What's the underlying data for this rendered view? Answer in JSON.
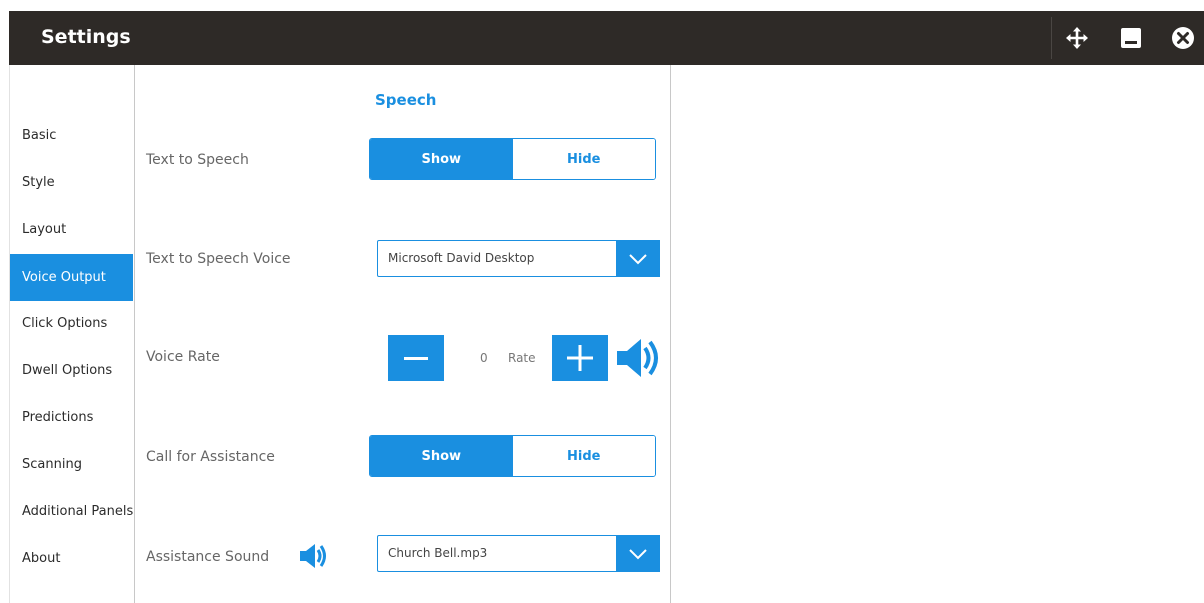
{
  "window": {
    "title": "Settings",
    "icons": {
      "move": "move-arrows-icon",
      "minimize": "minimize-icon",
      "close": "close-circle-icon"
    }
  },
  "sidebar": {
    "items": [
      {
        "label": "Basic",
        "active": false
      },
      {
        "label": "Style",
        "active": false
      },
      {
        "label": "Layout",
        "active": false
      },
      {
        "label": "Voice Output",
        "active": true
      },
      {
        "label": "Click Options",
        "active": false
      },
      {
        "label": "Dwell Options",
        "active": false
      },
      {
        "label": "Predictions",
        "active": false
      },
      {
        "label": "Scanning",
        "active": false
      },
      {
        "label": "Additional Panels",
        "active": false
      },
      {
        "label": "About",
        "active": false
      }
    ]
  },
  "main": {
    "section_title": "Speech",
    "text_to_speech": {
      "label": "Text to Speech",
      "show": "Show",
      "hide": "Hide",
      "selected": "Show"
    },
    "voice": {
      "label": "Text to Speech Voice",
      "value": "Microsoft David Desktop"
    },
    "voice_rate": {
      "label": "Voice Rate",
      "value": "0",
      "unit": "Rate"
    },
    "call_for_assistance": {
      "label": "Call for Assistance",
      "show": "Show",
      "hide": "Hide",
      "selected": "Show"
    },
    "assistance_sound": {
      "label": "Assistance Sound",
      "value": "Church Bell.mp3"
    }
  },
  "colors": {
    "accent": "#1a8fe0",
    "titlebar": "#2e2a27",
    "active_nav": "#1a8fe0"
  }
}
